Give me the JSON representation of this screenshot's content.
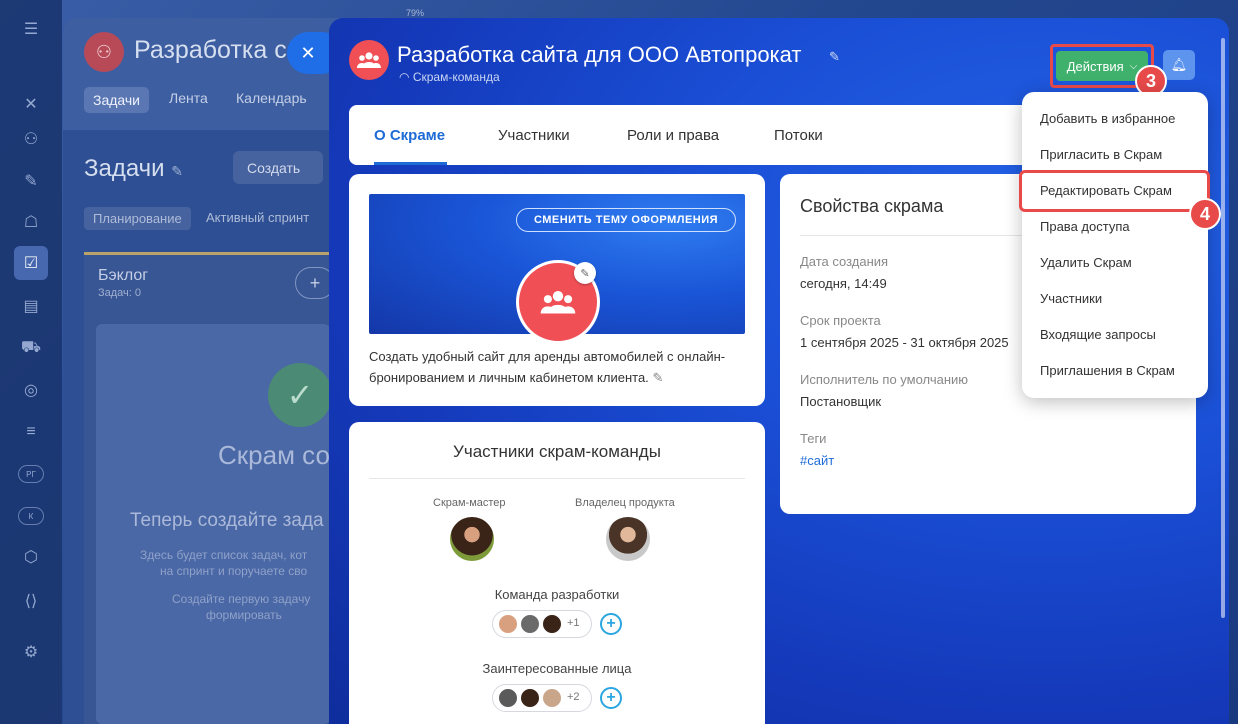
{
  "background": {
    "percent": "79%",
    "rail_pills": [
      "РГ",
      "К"
    ],
    "group_title": "Разработка с",
    "tabs": [
      "Задачи",
      "Лента",
      "Календарь"
    ],
    "section_title": "Задачи",
    "create_label": "Создать",
    "subtabs": [
      "Планирование",
      "Активный спринт"
    ],
    "backlog_title": "Бэклог",
    "backlog_sub": "Задач: 0",
    "empty_title": "Скрам со",
    "empty_line": "Теперь создайте зада",
    "empty_small": [
      "Здесь будет список задач, кот",
      "на спринт и поручаете сво",
      "Создайте первую задачу",
      "формировать"
    ]
  },
  "slider": {
    "title": "Разработка сайта для ООО Автопрокат",
    "subtitle": "Скрам-команда",
    "actions_label": "Действия",
    "tabs": [
      "О Скраме",
      "Участники",
      "Роли и права",
      "Потоки"
    ],
    "theme_button": "СМЕНИТЬ ТЕМУ ОФОРМЛЕНИЯ",
    "description": "Создать удобный сайт для аренды автомобилей с онлайн-бронированием и личным кабинетом клиента.",
    "team": {
      "title": "Участники скрам-команды",
      "scrum_master_label": "Скрам-мастер",
      "owner_label": "Владелец продукта",
      "dev_team_label": "Команда разработки",
      "dev_extra": "+1",
      "stakeholders_label": "Заинтересованные лица",
      "stakeholders_extra": "+2"
    },
    "properties": {
      "title": "Свойства скрама",
      "created_label": "Дата создания",
      "created_value": "сегодня, 14:49",
      "term_label": "Срок проекта",
      "term_value": "1 сентября 2025 - 31 октября 2025",
      "assignee_label": "Исполнитель по умолчанию",
      "assignee_value": "Постановщик",
      "tags_label": "Теги",
      "tag": "#сайт"
    }
  },
  "menu": {
    "items": [
      "Добавить в избранное",
      "Пригласить в Скрам",
      "Редактировать Скрам",
      "Права доступа",
      "Удалить Скрам",
      "Участники",
      "Входящие запросы",
      "Приглашения в Скрам"
    ]
  },
  "steps": [
    "3",
    "4"
  ],
  "colors": {
    "accent": "#1f6bd6",
    "actions": "#3fb16c",
    "highlight": "#e84a4a",
    "avatar": "#ef4f55"
  }
}
